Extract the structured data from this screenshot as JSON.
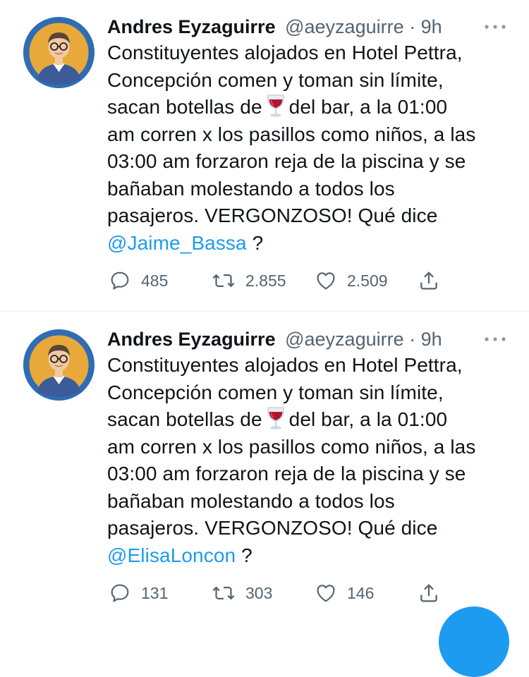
{
  "colors": {
    "text": "#0f1419",
    "secondary": "#536471",
    "link": "#1d9bf0",
    "divider": "#e6ecf0",
    "avatar_bg": "#2f6db3"
  },
  "tweets": [
    {
      "author": {
        "name": "Andres Eyzaguirre",
        "handle": "@aeyzaguirre",
        "separator": "·",
        "time": "9h",
        "avatar_icon": "avatar-illustration-icon"
      },
      "more_icon": "more-icon",
      "text_lines": [
        "Constituyentes alojados en Hotel Pettra,",
        "Concepción comen y toman sin límite,"
      ],
      "line3_before": "sacan botellas de",
      "emoji_icon": "wine-glass-icon",
      "line3_after": "del bar, a la 01:00",
      "text_lines_after": [
        "am corren x los pasillos como niños, a las",
        "03:00 am forzaron reja de la piscina y se",
        "bañaban molestando a todos los",
        "pasajeros. VERGONZOSO! Qué dice"
      ],
      "mention": "@Jaime_Bassa",
      "mention_suffix": "?",
      "actions": {
        "reply_count": "485",
        "retweet_count": "2.855",
        "like_count": "2.509"
      }
    },
    {
      "author": {
        "name": "Andres Eyzaguirre",
        "handle": "@aeyzaguirre",
        "separator": "·",
        "time": "9h",
        "avatar_icon": "avatar-illustration-icon"
      },
      "more_icon": "more-icon",
      "text_lines": [
        "Constituyentes alojados en Hotel Pettra,",
        "Concepción comen y toman sin límite,"
      ],
      "line3_before": "sacan botellas de",
      "emoji_icon": "wine-glass-icon",
      "line3_after": "del bar, a la 01:00",
      "text_lines_after": [
        "am corren x los pasillos como niños, a las",
        "03:00 am forzaron reja de la piscina y se",
        "bañaban molestando a todos los",
        "pasajeros. VERGONZOSO! Qué dice"
      ],
      "mention": "@ElisaLoncon",
      "mention_suffix": "?",
      "actions": {
        "reply_count": "131",
        "retweet_count": "303",
        "like_count": "146"
      }
    }
  ],
  "compose_button_icon": "compose-fab-icon"
}
